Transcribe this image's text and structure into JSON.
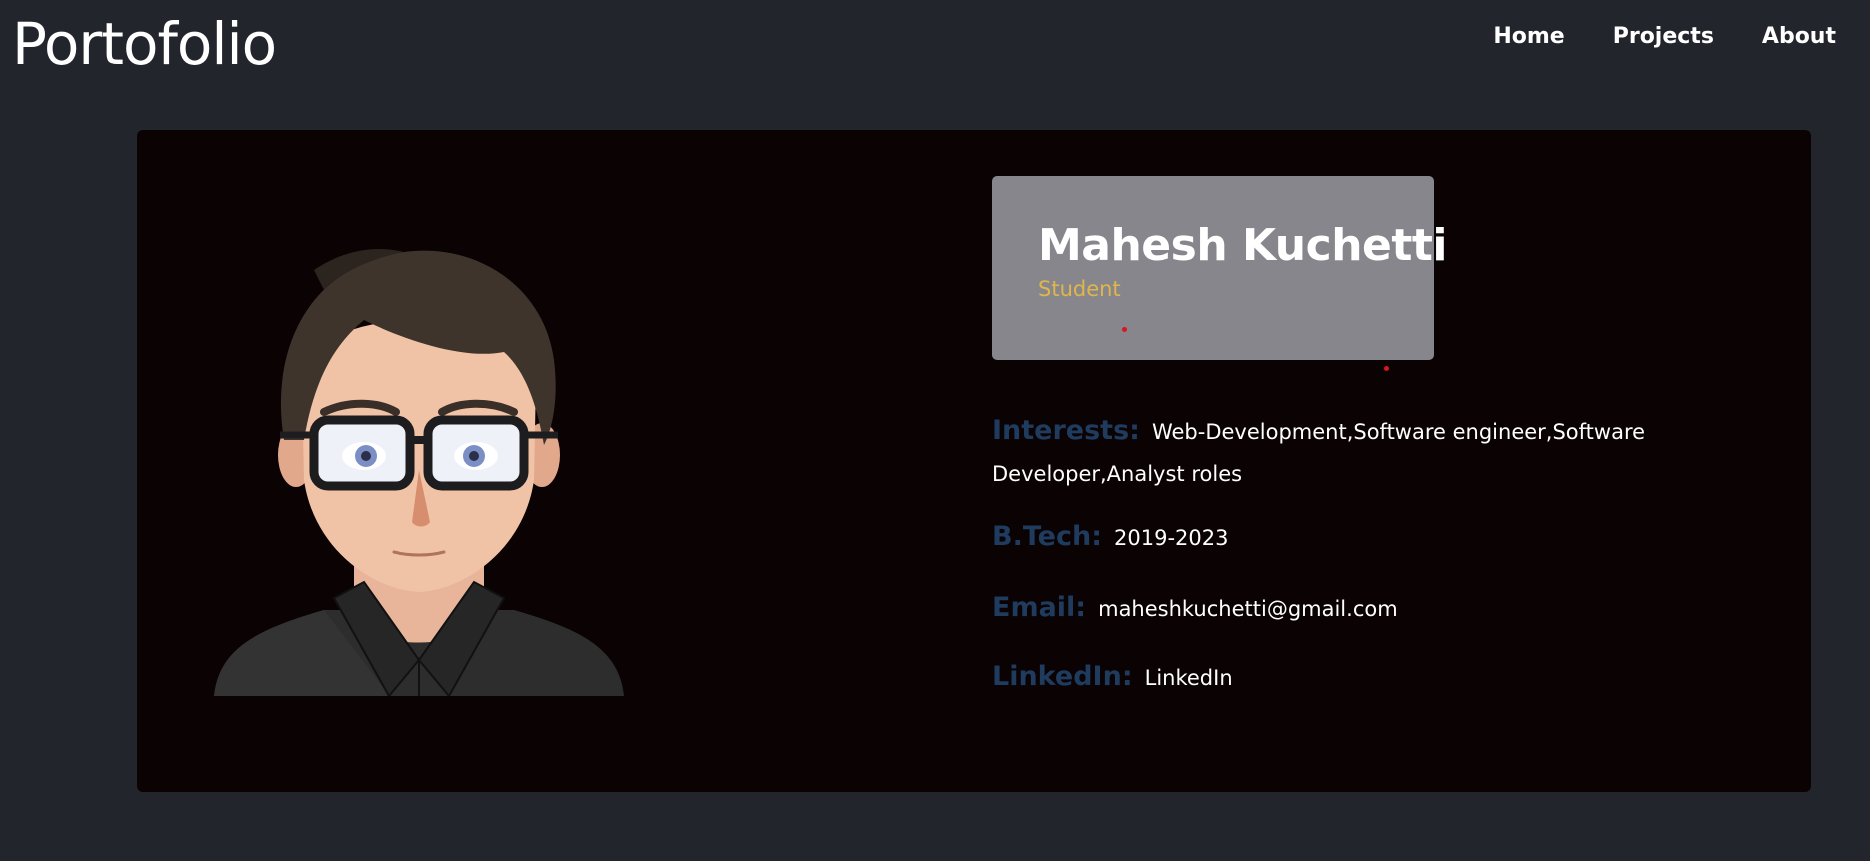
{
  "header": {
    "brand": "Portofolio",
    "nav": [
      "Home",
      "Projects",
      "About"
    ]
  },
  "profile": {
    "name": "Mahesh Kuchetti",
    "role": "Student",
    "interests_label": "Interests:",
    "interests_value": "Web-Development,Software engineer,Software Developer,Analyst roles",
    "btech_label": "B.Tech:",
    "btech_value": "2019-2023",
    "email_label": "Email:",
    "email_value": "maheshkuchetti@gmail.com",
    "linkedin_label": "LinkedIn:",
    "linkedin_value": "LinkedIn"
  },
  "colors": {
    "page_bg": "#22252b",
    "card_bg": "#0a0203",
    "name_box_bg": "#87868c",
    "role": "#e0b64a",
    "label": "#1f3b5e"
  }
}
